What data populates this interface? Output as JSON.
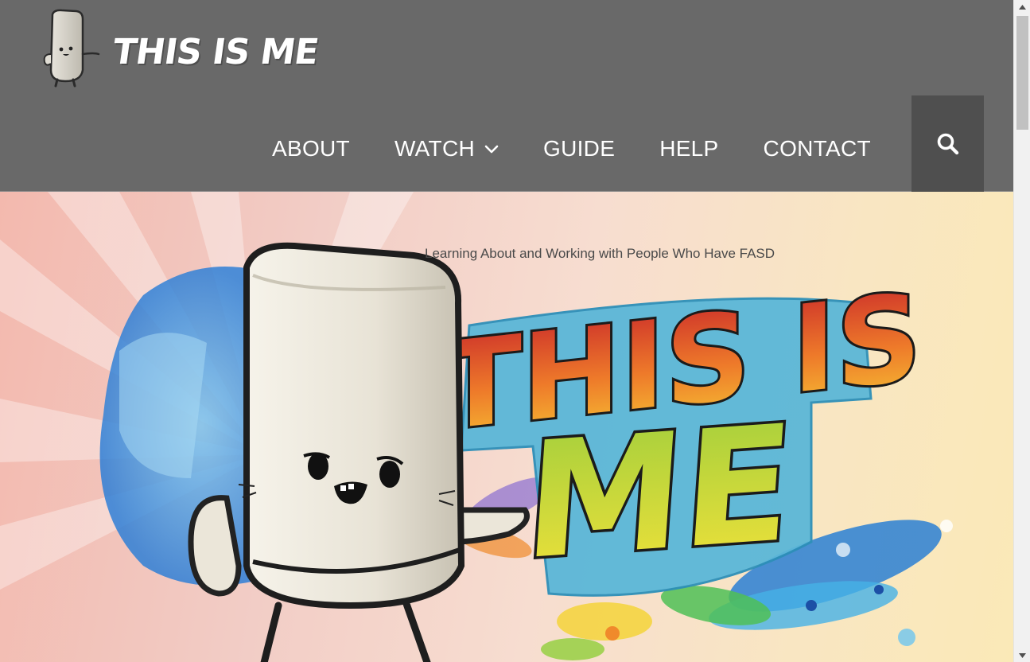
{
  "header": {
    "logo_text": "THIS IS ME",
    "logo_icon": "mascot-icon",
    "background_color": "#696969"
  },
  "nav": {
    "items": [
      {
        "label": "ABOUT",
        "has_dropdown": false
      },
      {
        "label": "WATCH",
        "has_dropdown": true
      },
      {
        "label": "GUIDE",
        "has_dropdown": false
      },
      {
        "label": "HELP",
        "has_dropdown": false
      },
      {
        "label": "CONTACT",
        "has_dropdown": false
      }
    ],
    "dropdown_icon": "chevron-down-icon",
    "search_icon": "search-icon",
    "search_button_color": "#4f4f4f"
  },
  "hero": {
    "tagline": "Learning About and Working with People Who Have FASD",
    "title_line1": "THIS IS",
    "title_line2": "ME",
    "title_colors": {
      "this_is": "#d9322a",
      "me": "#b8d43a",
      "outline": "#4eb3d3"
    }
  },
  "scrollbar": {
    "up_icon": "scroll-up-arrow-icon",
    "down_icon": "scroll-down-arrow-icon"
  }
}
